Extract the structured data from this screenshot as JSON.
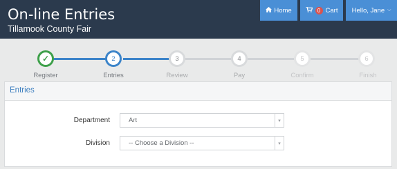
{
  "header": {
    "title": "On-line Entries",
    "subtitle": "Tillamook County Fair",
    "home_label": "Home",
    "home_icon": "home-icon",
    "cart_label": "Cart",
    "cart_icon": "cart-icon",
    "cart_count": "0",
    "user_label": "Hello, Jane"
  },
  "steps": [
    {
      "label": "Register",
      "number": "✓",
      "state": "complete"
    },
    {
      "label": "Entries",
      "number": "2",
      "state": "active"
    },
    {
      "label": "Review",
      "number": "3",
      "state": "upcoming"
    },
    {
      "label": "Pay",
      "number": "4",
      "state": "upcoming"
    },
    {
      "label": "Confirm",
      "number": "5",
      "state": "upcoming"
    },
    {
      "label": "Finish",
      "number": "6",
      "state": "upcoming"
    }
  ],
  "panel": {
    "title": "Entries",
    "department_label": "Department",
    "department_value": "Art",
    "division_label": "Division",
    "division_value": "-- Choose a Division --"
  },
  "colors": {
    "header_bg": "#2b3a4d",
    "nav_button": "#4a8fd6",
    "complete": "#3ea04a",
    "active": "#3c84c9",
    "badge": "#d9534f"
  }
}
